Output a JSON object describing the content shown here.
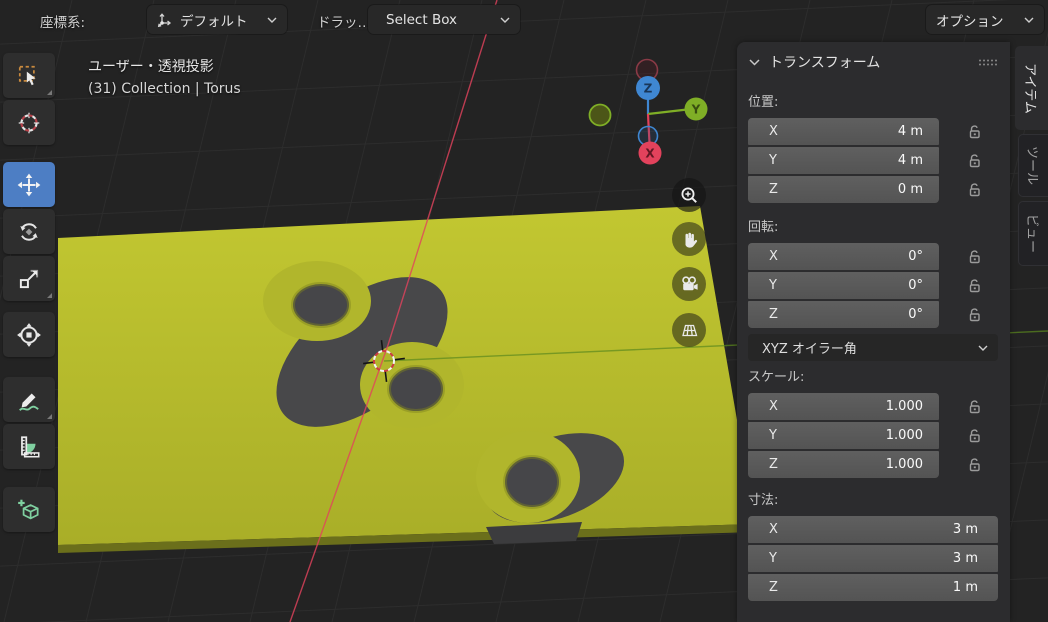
{
  "topbar": {
    "coordinate_label": "座標系:",
    "orientation_value": "デフォルト",
    "drag_label": "ドラッ…",
    "select_mode_value": "Select Box",
    "options_value": "オプション"
  },
  "viewport": {
    "view_info": "ユーザー・透視投影",
    "active_object": "(31) Collection | Torus",
    "gizmo": {
      "x_label": "X",
      "y_label": "Y",
      "z_label": "Z"
    }
  },
  "toolbar": {
    "tools": [
      {
        "name": "select-box",
        "active": false
      },
      {
        "name": "cursor",
        "active": false
      },
      {
        "name": "move",
        "active": true
      },
      {
        "name": "rotate",
        "active": false
      },
      {
        "name": "scale",
        "active": false
      },
      {
        "name": "transform",
        "active": false
      },
      {
        "name": "annotate",
        "active": false
      },
      {
        "name": "measure",
        "active": false
      },
      {
        "name": "add-cube",
        "active": false
      }
    ]
  },
  "sidebar": {
    "title": "トランスフォーム",
    "location": {
      "label": "位置:",
      "rows": [
        {
          "axis": "X",
          "value": "4 m"
        },
        {
          "axis": "Y",
          "value": "4 m"
        },
        {
          "axis": "Z",
          "value": "0 m"
        }
      ]
    },
    "rotation": {
      "label": "回転:",
      "rows": [
        {
          "axis": "X",
          "value": "0°"
        },
        {
          "axis": "Y",
          "value": "0°"
        },
        {
          "axis": "Z",
          "value": "0°"
        }
      ],
      "mode": "XYZ オイラー角"
    },
    "scale": {
      "label": "スケール:",
      "rows": [
        {
          "axis": "X",
          "value": "1.000"
        },
        {
          "axis": "Y",
          "value": "1.000"
        },
        {
          "axis": "Z",
          "value": "1.000"
        }
      ]
    },
    "dimensions": {
      "label": "寸法:",
      "rows": [
        {
          "axis": "X",
          "value": "3 m"
        },
        {
          "axis": "Y",
          "value": "3 m"
        },
        {
          "axis": "Z",
          "value": "1 m"
        }
      ]
    },
    "tabs": [
      {
        "label": "アイテム",
        "active": true
      },
      {
        "label": "ツール",
        "active": false
      },
      {
        "label": "ビュー",
        "active": false
      }
    ]
  },
  "colors": {
    "accent": "#4d7ec4",
    "vp_bg": "#232323",
    "grid_line": "#2d2d2d",
    "plane_yellow": "#b6bb2e",
    "shadow_gray": "#48484a",
    "panel_bg": "#2c2c2e",
    "field_bg": "#575757",
    "widget_bg": "#282828",
    "axis_x": "#e2425c",
    "axis_y": "#7fae26",
    "axis_z": "#3f87d2",
    "cursor_red": "#cc3b44",
    "annotate_green": "#7fd0a0"
  }
}
